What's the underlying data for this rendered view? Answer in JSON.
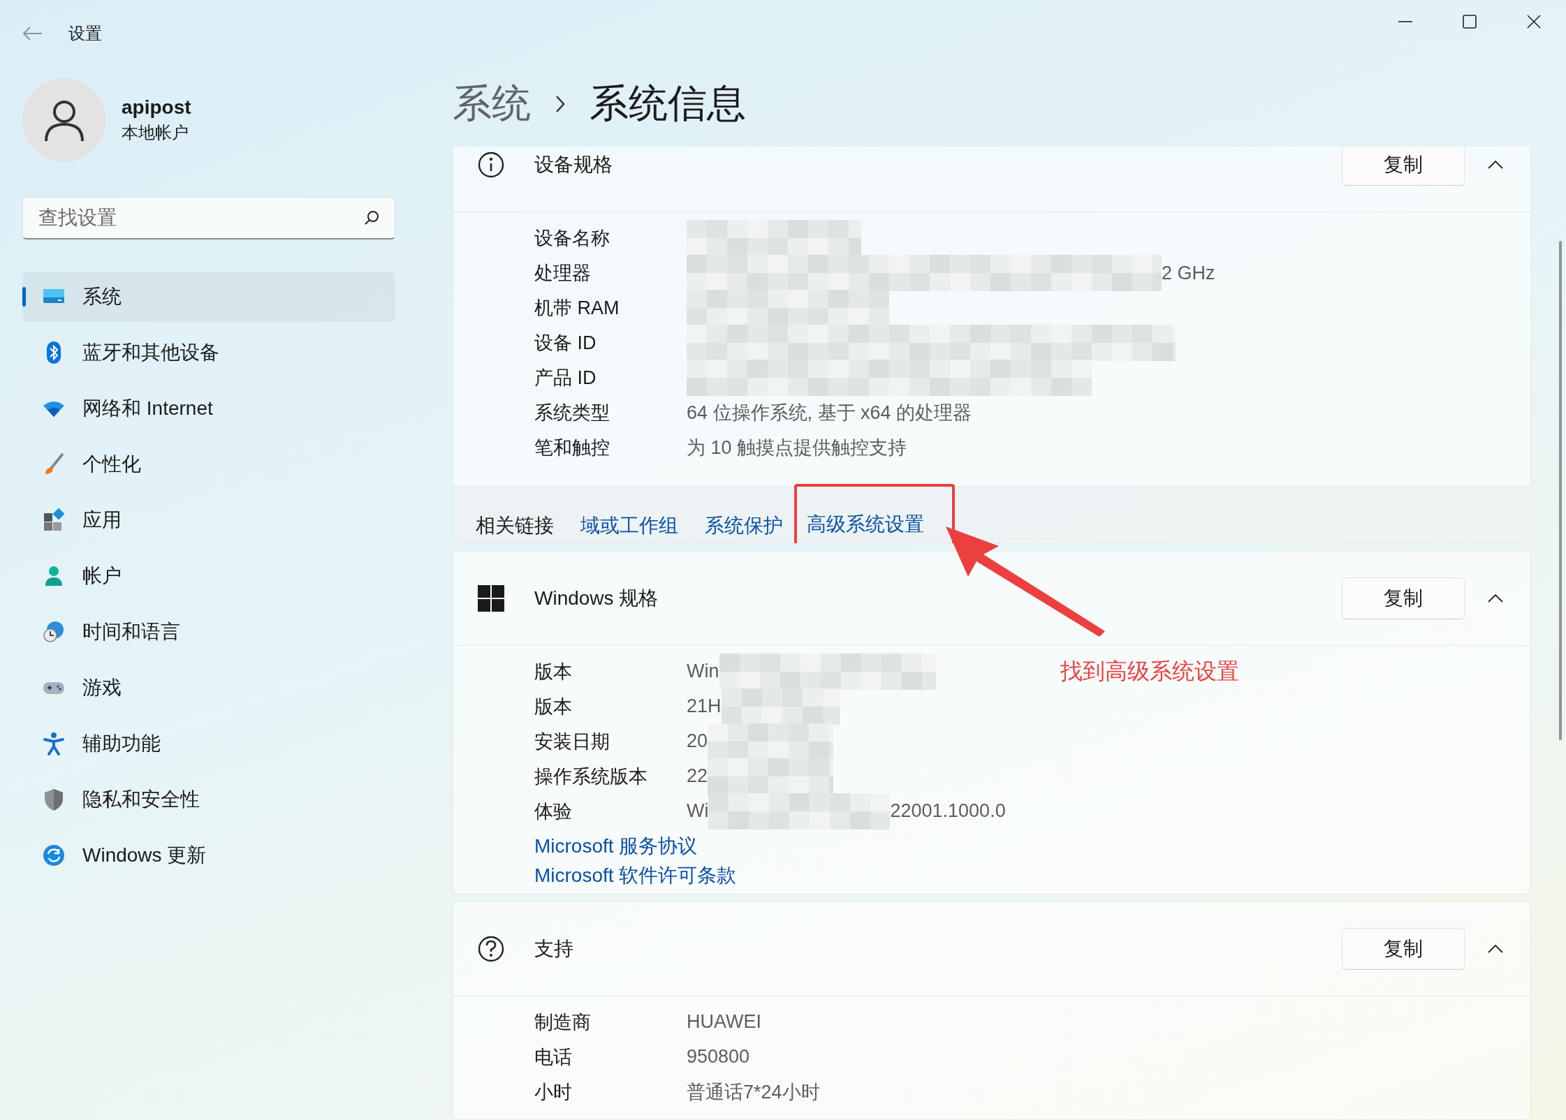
{
  "window": {
    "title": "设置"
  },
  "account": {
    "name": "apipost",
    "type": "本地帐户"
  },
  "search": {
    "placeholder": "查找设置"
  },
  "nav": [
    {
      "label": "系统",
      "selected": true
    },
    {
      "label": "蓝牙和其他设备",
      "selected": false
    },
    {
      "label": "网络和 Internet",
      "selected": false
    },
    {
      "label": "个性化",
      "selected": false
    },
    {
      "label": "应用",
      "selected": false
    },
    {
      "label": "帐户",
      "selected": false
    },
    {
      "label": "时间和语言",
      "selected": false
    },
    {
      "label": "游戏",
      "selected": false
    },
    {
      "label": "辅助功能",
      "selected": false
    },
    {
      "label": "隐私和安全性",
      "selected": false
    },
    {
      "label": "Windows 更新",
      "selected": false
    }
  ],
  "breadcrumb": {
    "parent": "系统",
    "current": "系统信息"
  },
  "sections": [
    {
      "title": "设备规格",
      "copy_button": "复制",
      "expanded": true,
      "rows": [
        {
          "label": "设备名称",
          "redacted": true
        },
        {
          "label": "处理器",
          "redacted": true,
          "value_end": "2 GHz"
        },
        {
          "label": "机带 RAM",
          "redacted": true
        },
        {
          "label": "设备 ID",
          "redacted": true
        },
        {
          "label": "产品 ID",
          "redacted": true
        },
        {
          "label": "系统类型",
          "value": "64 位操作系统, 基于 x64 的处理器",
          "redacted": false
        },
        {
          "label": "笔和触控",
          "value": "为 10 触摸点提供触控支持",
          "redacted": false
        }
      ],
      "related": {
        "label": "相关链接",
        "links": [
          {
            "label": "域或工作组",
            "highlighted": false
          },
          {
            "label": "系统保护",
            "highlighted": false
          },
          {
            "label": "高级系统设置",
            "highlighted": true
          }
        ]
      }
    },
    {
      "title": "Windows 规格",
      "copy_button": "复制",
      "expanded": true,
      "rows": [
        {
          "label": "版本",
          "value": "Win",
          "redacted": true
        },
        {
          "label": "版本",
          "value": "21H",
          "redacted": true
        },
        {
          "label": "安装日期",
          "value": "20",
          "redacted": true
        },
        {
          "label": "操作系统版本",
          "value": "22",
          "redacted": true
        },
        {
          "label": "体验",
          "value": "Wi",
          "redacted": true,
          "value_end": "22001.1000.0"
        }
      ],
      "links": [
        "Microsoft 服务协议",
        "Microsoft 软件许可条款"
      ]
    },
    {
      "title": "支持",
      "copy_button": "复制",
      "expanded": true,
      "rows": [
        {
          "label": "制造商",
          "value": "HUAWEI",
          "redacted": false
        },
        {
          "label": "电话",
          "value": "950800",
          "redacted": false
        },
        {
          "label": "小时",
          "value": "普通话7*24小时",
          "redacted": false
        }
      ]
    }
  ],
  "annotation": {
    "text": "找到高级系统设置"
  }
}
